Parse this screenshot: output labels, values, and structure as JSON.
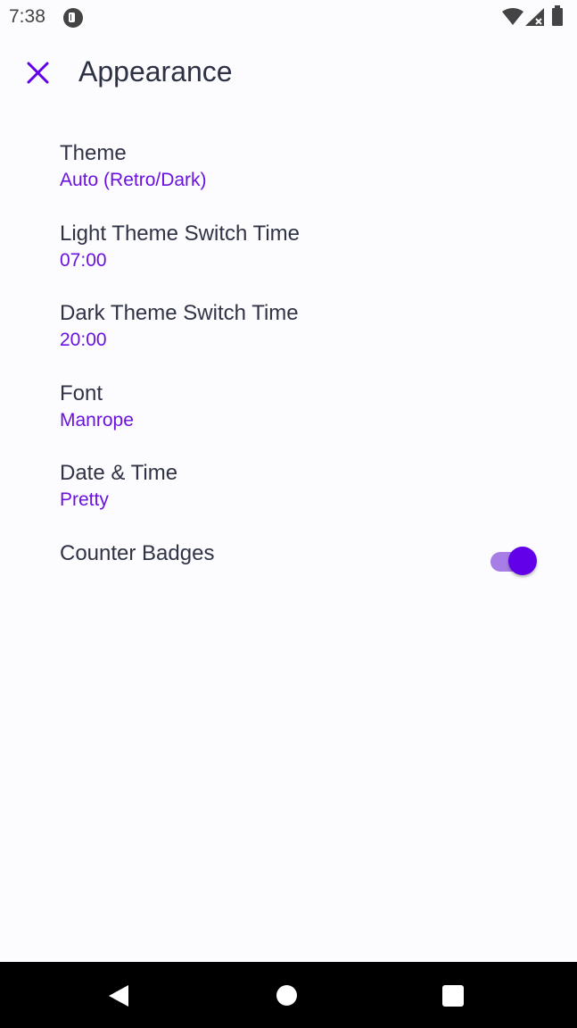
{
  "status_bar": {
    "time": "7:38",
    "app_icon": "pocket-casts-icon",
    "wifi_icon": "wifi-icon",
    "signal_icon": "signal-icon",
    "battery_icon": "battery-icon"
  },
  "toolbar": {
    "close_icon": "close-icon",
    "title": "Appearance"
  },
  "settings": [
    {
      "title": "Theme",
      "value": "Auto (Retro/Dark)"
    },
    {
      "title": "Light Theme Switch Time",
      "value": "07:00"
    },
    {
      "title": "Dark Theme Switch Time",
      "value": "20:00"
    },
    {
      "title": "Font",
      "value": "Manrope"
    },
    {
      "title": "Date & Time",
      "value": "Pretty"
    },
    {
      "title": "Counter Badges",
      "toggle_on": true
    }
  ],
  "nav_bar": {
    "back_icon": "back-icon",
    "home_icon": "home-icon",
    "recents_icon": "recents-icon"
  },
  "colors": {
    "accent": "#6200ea",
    "value_text": "#6a12e0",
    "title_text": "#2f3345",
    "background": "#fcfbfd"
  }
}
